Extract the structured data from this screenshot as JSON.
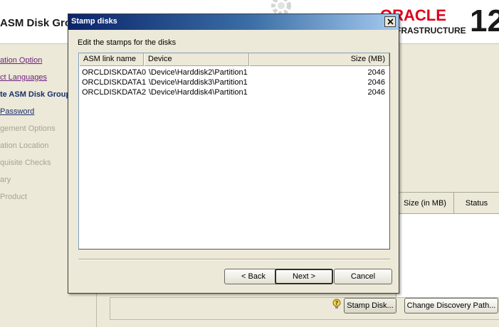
{
  "background": {
    "title": "ASM Disk Grou",
    "logo": {
      "brand": "ORACLE",
      "subtitle": "FRASTRUCTURE",
      "version": "12",
      "brand_color": "#e0001b"
    },
    "nav_items": [
      {
        "label": "ation Option",
        "state": "done"
      },
      {
        "label": "ct Languages",
        "state": "done"
      },
      {
        "label": "te ASM Disk Group",
        "state": "current"
      },
      {
        "label": "Password",
        "state": "link"
      },
      {
        "label": "gement Options",
        "state": "pending"
      },
      {
        "label": "ation Location",
        "state": "pending"
      },
      {
        "label": "quisite Checks",
        "state": "pending"
      },
      {
        "label": "ary",
        "state": "pending"
      },
      {
        "label": "Product",
        "state": "pending"
      }
    ],
    "table_headers": [
      "Size (in MB)",
      "Status"
    ],
    "buttons": {
      "stamp_disk": "Stamp Disk...",
      "change_discovery_path": "Change Discovery Path..."
    },
    "icons": {
      "help": "help-bulb-icon",
      "gear": "gear-icon"
    }
  },
  "dialog": {
    "title": "Stamp disks",
    "instruction": "Edit the stamps for the disks",
    "columns": [
      "ASM link name",
      "Device",
      "Size (MB)"
    ],
    "rows": [
      {
        "name": "ORCLDISKDATA0",
        "device": "\\Device\\Harddisk2\\Partition1",
        "size": "2046"
      },
      {
        "name": "ORCLDISKDATA1",
        "device": "\\Device\\Harddisk3\\Partition1",
        "size": "2046"
      },
      {
        "name": "ORCLDISKDATA2",
        "device": "\\Device\\Harddisk4\\Partition1",
        "size": "2046"
      }
    ],
    "buttons": {
      "back": "< Back",
      "next": "Next >",
      "cancel": "Cancel"
    },
    "close_icon": "close-icon",
    "titlebar_color": "#0a246a"
  }
}
